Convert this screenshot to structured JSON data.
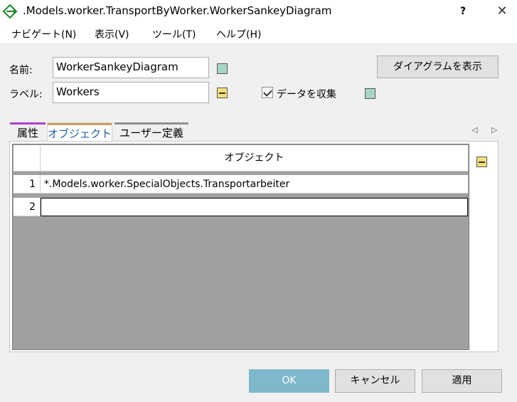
{
  "window": {
    "title": ".Models.worker.TransportByWorker.WorkerSankeyDiagram",
    "help_label": "?",
    "close_label": "✕"
  },
  "menu": {
    "items": [
      "ナビゲート(N)",
      "表示(V)",
      "ツール(T)",
      "ヘルプ(H)"
    ]
  },
  "form": {
    "name_label": "名前:",
    "name_value": "WorkerSankeyDiagram",
    "label_label": "ラベル:",
    "label_value": "Workers",
    "show_diagram_button": "ダイアグラムを表示",
    "collect_data_label": "データを収集",
    "collect_data_checked": true
  },
  "tabs": [
    {
      "label": "属性",
      "color": "#b040d0",
      "active": false
    },
    {
      "label": "オブジェクト",
      "color": "#c8a060",
      "active": true
    },
    {
      "label": "ユーザー定義",
      "color": "#909090",
      "active": false
    }
  ],
  "nav_arrows": "◁ ▷",
  "table": {
    "column_header": "オブジェクト",
    "rows": [
      {
        "num": "1",
        "value": "*.Models.worker.SpecialObjects.Transportarbeiter"
      },
      {
        "num": "2",
        "value": ""
      }
    ]
  },
  "footer": {
    "ok_label": "OK",
    "cancel_label": "キャンセル",
    "apply_label": "適用"
  },
  "colors": {
    "primary_button": "#7fb8cc",
    "teal_indicator": "#a8d6c5",
    "yellow_indicator": "#f6e07a"
  }
}
